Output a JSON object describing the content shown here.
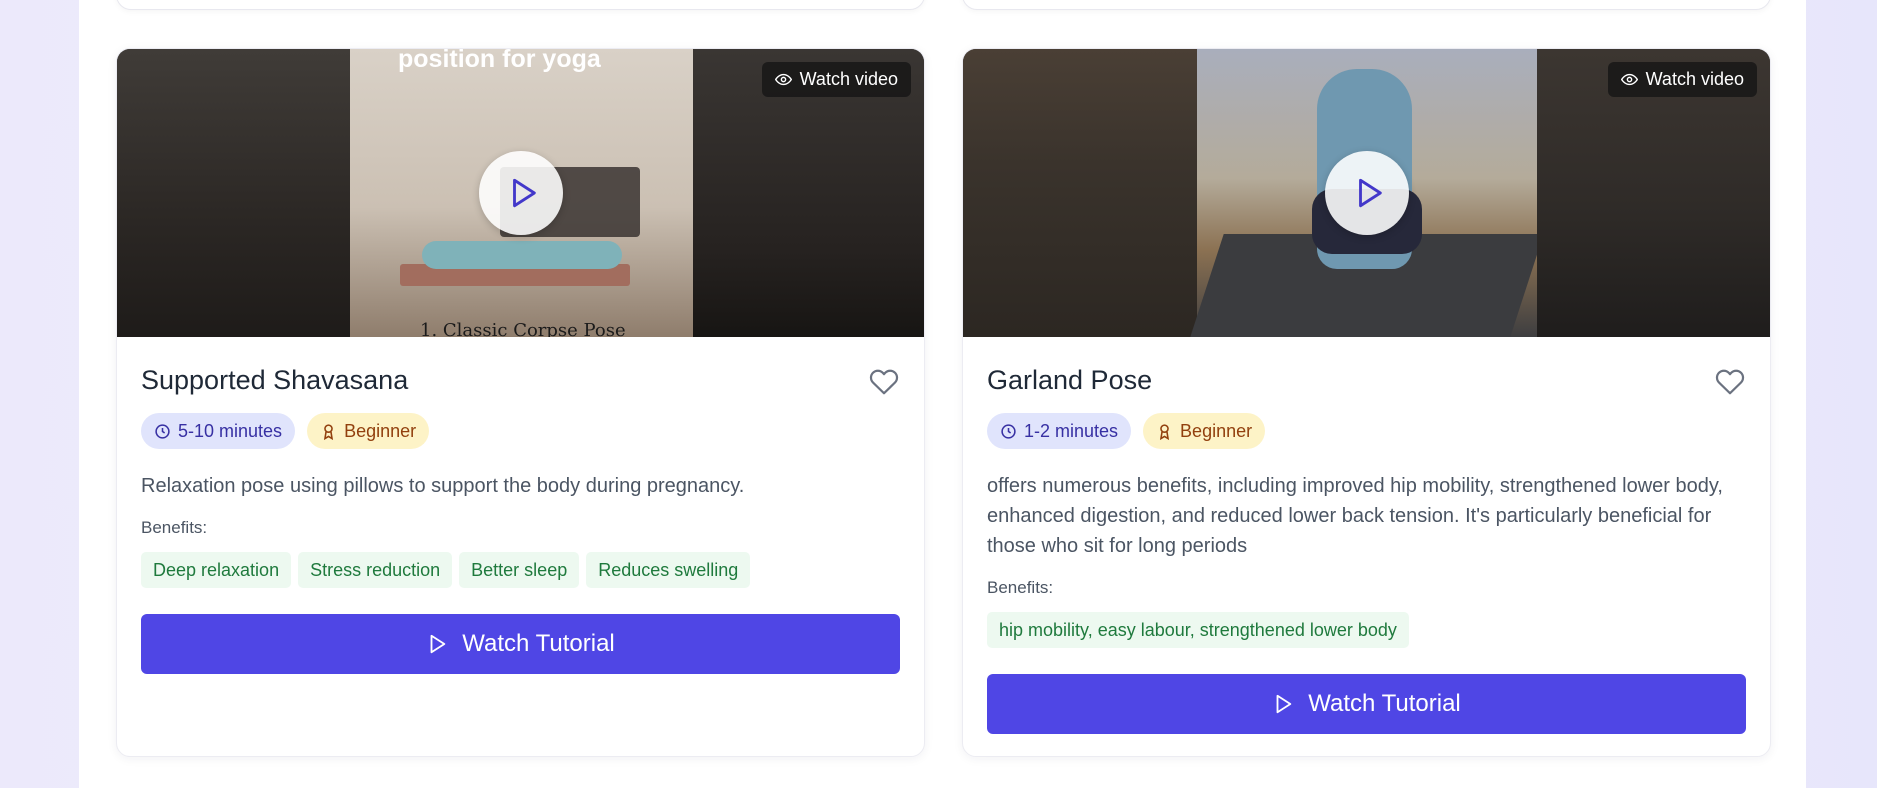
{
  "cards": [
    {
      "title": "Supported Shavasana",
      "video_chip": "Watch video",
      "duration": "5-10 minutes",
      "level": "Beginner",
      "description": "Relaxation pose using pillows to support the body during pregnancy.",
      "benefits_label": "Benefits:",
      "benefits": [
        "Deep relaxation",
        "Stress reduction",
        "Better sleep",
        "Reduces swelling"
      ],
      "cta": "Watch Tutorial",
      "thumbnail_caption_top": "position for yoga",
      "thumbnail_caption_bottom": "1. Classic Corpse Pose"
    },
    {
      "title": "Garland Pose",
      "video_chip": "Watch video",
      "duration": "1-2 minutes",
      "level": "Beginner",
      "description": "offers numerous benefits, including improved hip mobility, strengthened lower body, enhanced digestion, and reduced lower back tension. It's particularly beneficial for those who sit for long periods",
      "benefits_label": "Benefits:",
      "benefits": [
        "hip mobility, easy labour, strengthened lower body"
      ],
      "cta": "Watch Tutorial"
    }
  ],
  "icons": {
    "watch": "eye-icon",
    "play": "play-icon",
    "favorite": "heart-icon",
    "duration": "clock-icon",
    "level": "award-icon"
  },
  "colors": {
    "accent": "#4f46e5",
    "duration_bg": "#e0e4fc",
    "level_bg": "#fdf3c7",
    "benefit_bg": "#edf9f0",
    "benefit_text": "#1f7a3d"
  }
}
